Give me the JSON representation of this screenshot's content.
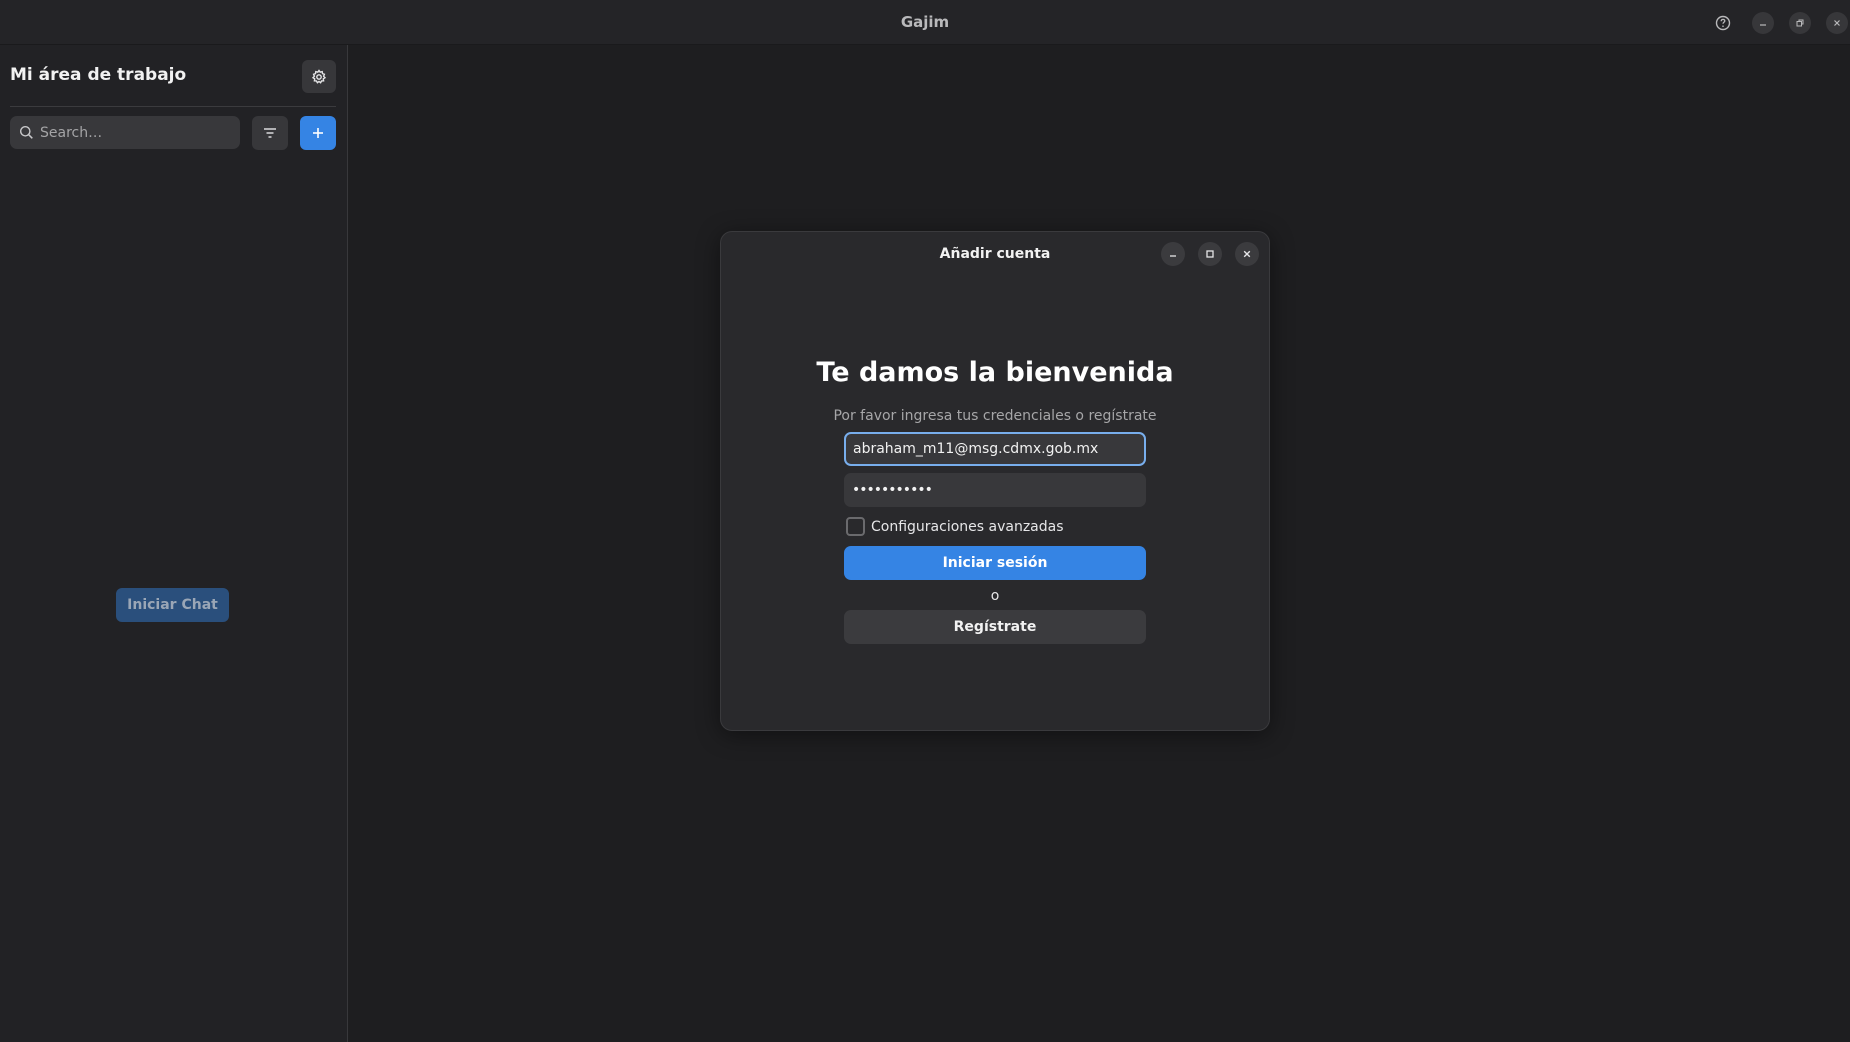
{
  "window": {
    "title": "Gajim",
    "controls": [
      "help-icon",
      "minimize-icon",
      "restore-icon",
      "close-icon"
    ]
  },
  "sidebar": {
    "workspace_title": "Mi área de trabajo",
    "search": {
      "placeholder": "Search…",
      "value": ""
    },
    "start_chat_label": "Iniciar Chat"
  },
  "dialog": {
    "title": "Añadir cuenta",
    "welcome_title": "Te damos la bienvenida",
    "welcome_subtitle": "Por favor ingresa tus credenciales o regístrate",
    "email_value": "abraham_m11@msg.cdmx.gob.mx",
    "password_masked": "•••••••••••",
    "advanced_label": "Configuraciones avanzadas",
    "advanced_checked": false,
    "login_label": "Iniciar sesión",
    "or_label": "o",
    "register_label": "Regístrate"
  },
  "colors": {
    "accent": "#3584e4",
    "background": "#1e1e20",
    "sidebar": "#222225",
    "dialog": "#29292c"
  }
}
